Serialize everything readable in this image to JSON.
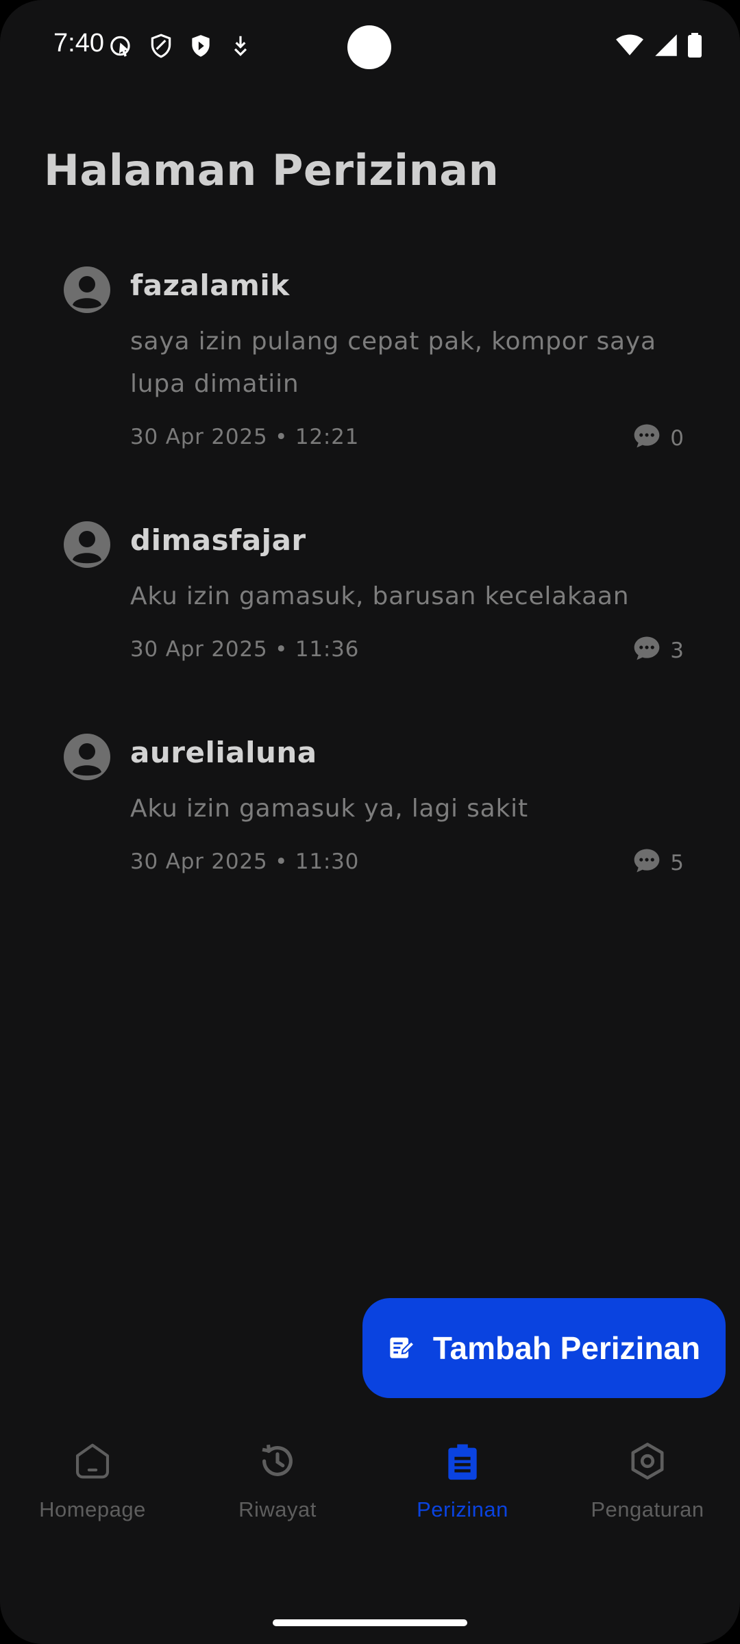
{
  "status_bar": {
    "time": "7:40",
    "left_icons": [
      "screen-record-icon",
      "shield-outline-icon",
      "shield-play-icon",
      "download-icon"
    ],
    "right_icons": [
      "wifi-icon",
      "signal-icon",
      "battery-icon"
    ]
  },
  "page": {
    "title": "Halaman Perizinan"
  },
  "posts": [
    {
      "username": "fazalamik",
      "message": "saya izin pulang cepat pak, kompor saya lupa dimatiin",
      "meta": "30 Apr 2025 • 12:21",
      "comments": "0"
    },
    {
      "username": "dimasfajar",
      "message": "Aku izin gamasuk, barusan kecelakaan",
      "meta": "30 Apr 2025 • 11:36",
      "comments": "3"
    },
    {
      "username": "aurelialuna",
      "message": "Aku izin gamasuk ya, lagi sakit",
      "meta": "30 Apr 2025 • 11:30",
      "comments": "5"
    }
  ],
  "fab": {
    "label": "Tambah Perizinan",
    "icon": "edit-note-icon"
  },
  "nav": {
    "items": [
      {
        "label": "Homepage",
        "icon": "home-icon",
        "active": false
      },
      {
        "label": "Riwayat",
        "icon": "history-icon",
        "active": false
      },
      {
        "label": "Perizinan",
        "icon": "clipboard-icon",
        "active": true
      },
      {
        "label": "Pengaturan",
        "icon": "settings-icon",
        "active": false
      }
    ]
  },
  "colors": {
    "background": "#121213",
    "accent": "#0a43e0",
    "text_primary": "#d3d3d3",
    "text_muted": "#7d7d7d"
  }
}
